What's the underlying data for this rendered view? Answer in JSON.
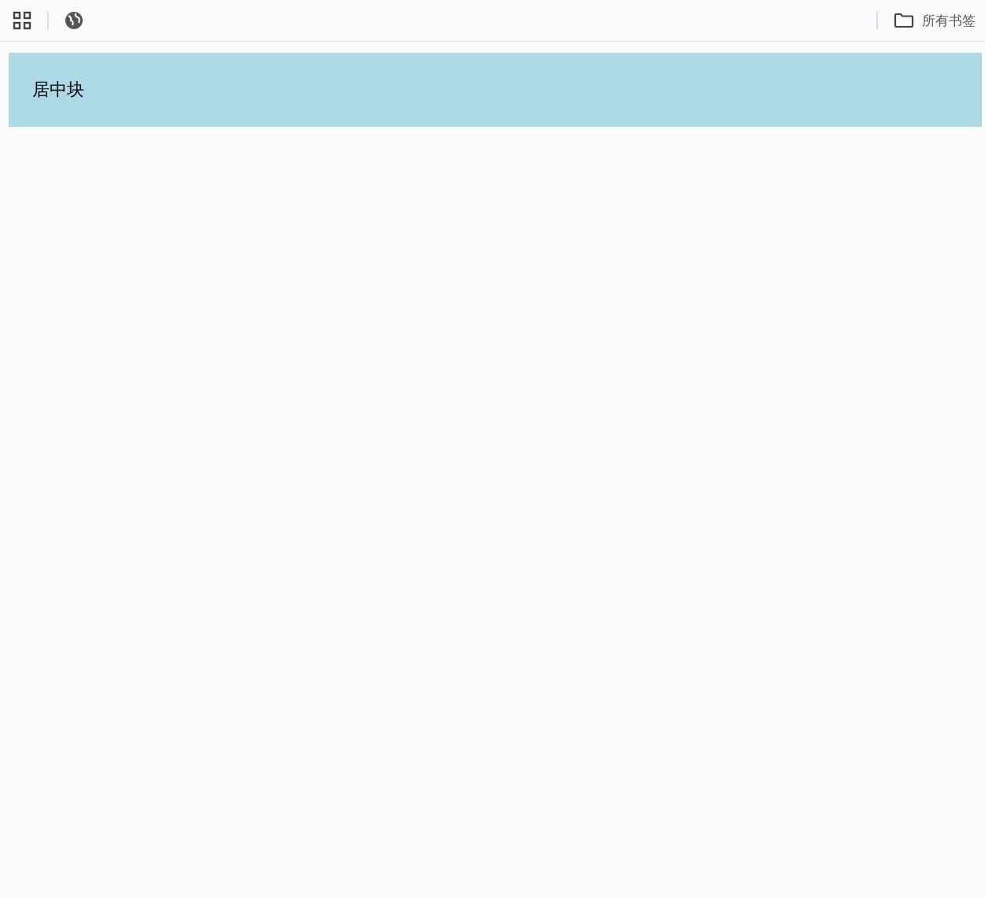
{
  "bookmarks_bar": {
    "folder_label": "所有书签"
  },
  "content": {
    "block_text": "居中块"
  }
}
